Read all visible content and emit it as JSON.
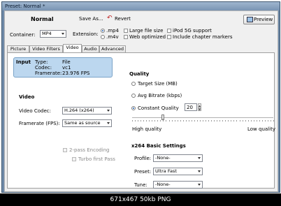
{
  "window": {
    "title": "Preset: Normal *"
  },
  "toolbar": {
    "preset_name": "Normal",
    "save_as": "Save As...",
    "revert": "Revert",
    "preview": "Preview"
  },
  "container": {
    "label": "Container:",
    "value": "MP4"
  },
  "extension": {
    "label": "Extension:",
    "options": [
      ".mp4",
      ".m4v"
    ],
    "selected": ".mp4"
  },
  "options": {
    "large_file": "Large file size",
    "web_optimized": "Web optimized",
    "ipod": "iPod 5G support",
    "chapters": "Include chapter markers"
  },
  "tabs": [
    "Picture",
    "Video Filters",
    "Video",
    "Audio",
    "Advanced"
  ],
  "active_tab": "Video",
  "input": {
    "heading": "Input",
    "type_label": "Type:",
    "type_value": "File",
    "codec_label": "Codec:",
    "codec_value": "vc1",
    "framerate_label": "Framerate:",
    "framerate_value": "23.976 FPS"
  },
  "video": {
    "heading": "Video",
    "codec_label": "Video Codec:",
    "codec_value": "H.264 (x264)",
    "fps_label": "Framerate (FPS):",
    "fps_value": "Same as source",
    "twopass": "2-pass Encoding",
    "turbo": "Turbo first Pass"
  },
  "quality": {
    "heading": "Quality",
    "target_size": "Target Size (MB)",
    "avg_bitrate": "Avg Bitrate (kbps)",
    "constant_quality": "Constant Quality",
    "cq_value": "20",
    "high": "High quality",
    "low": "Low quality",
    "slider_level": 0.22
  },
  "x264": {
    "heading": "x264 Basic Settings",
    "profile_label": "Profile:",
    "profile_value": "-None-",
    "preset_label": "Preset:",
    "preset_value": "Ultra Fast",
    "tune_label": "Tune:",
    "tune_value": "-None-"
  },
  "footer": {
    "text": "671x467  50kb  PNG"
  }
}
